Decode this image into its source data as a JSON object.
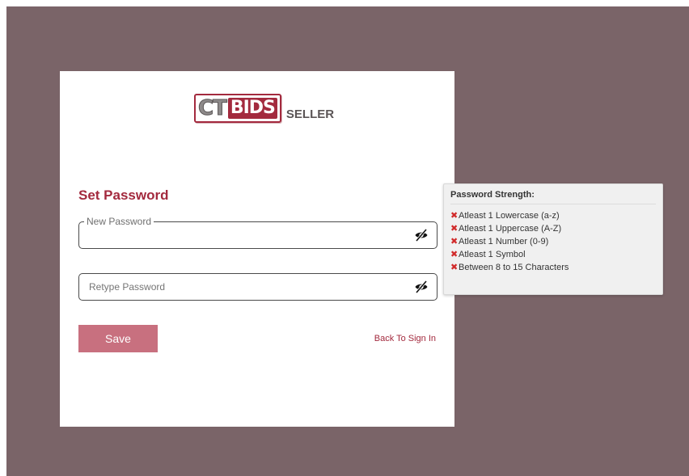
{
  "logo": {
    "ct": "CT",
    "bids": "BIDS",
    "seller": "SELLER"
  },
  "form": {
    "title": "Set Password",
    "new_password_label": "New Password",
    "retype_password_placeholder": "Retype Password",
    "save_label": "Save",
    "back_link": "Back To Sign In"
  },
  "strength": {
    "title": "Password Strength:",
    "rules": [
      {
        "icon": "x-mark-icon",
        "text": "Atleast 1 Lowercase (a-z)"
      },
      {
        "icon": "x-mark-icon",
        "text": "Atleast 1 Uppercase (A-Z)"
      },
      {
        "icon": "x-mark-icon",
        "text": "Atleast 1 Number (0-9)"
      },
      {
        "icon": "x-mark-icon",
        "text": "Atleast 1 Symbol"
      },
      {
        "icon": "x-mark-icon",
        "text": "Between 8 to 15 Characters"
      }
    ]
  },
  "icons": {
    "password_toggle": "eye-slash-icon"
  },
  "colors": {
    "brand": "#a32a3e",
    "backdrop": "#7a6468",
    "button": "#c8707f",
    "fail": "#d12b2b"
  }
}
